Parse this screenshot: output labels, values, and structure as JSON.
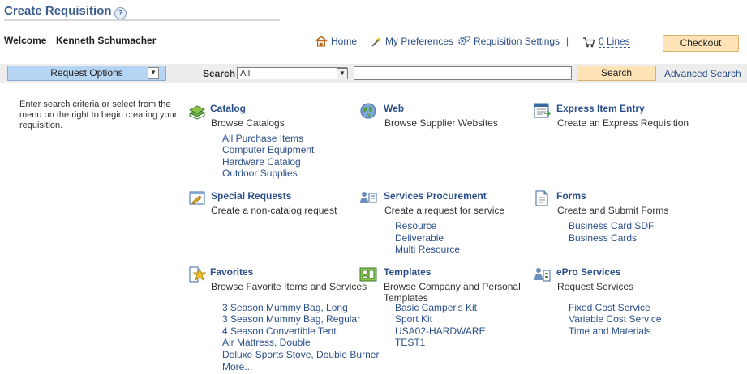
{
  "page": {
    "title": "Create Requisition",
    "help": "?"
  },
  "welcome": {
    "label": "Welcome",
    "name": "Kenneth Schumacher"
  },
  "nav": {
    "home": "Home",
    "preferences": "My Preferences",
    "settings": "Requisition Settings",
    "separator": "|",
    "lines": "0 Lines",
    "checkout": "Checkout"
  },
  "search": {
    "request_options": "Request Options",
    "label": "Search",
    "category_value": "All",
    "query_value": "",
    "button": "Search",
    "advanced": "Advanced Search"
  },
  "instructions": "Enter search criteria or select from the menu on the right to begin creating your requisition.",
  "categories": [
    {
      "title": "Catalog",
      "desc": "Browse Catalogs",
      "icon": "books-icon",
      "items": [
        "All Purchase Items",
        "Computer Equipment",
        "Hardware Catalog",
        "Outdoor Supplies"
      ]
    },
    {
      "title": "Web",
      "desc": "Browse Supplier Websites",
      "icon": "globe-icon",
      "items": []
    },
    {
      "title": "Express Item Entry",
      "desc": "Create an Express Requisition",
      "icon": "express-entry-icon",
      "items": []
    },
    {
      "title": "Special Requests",
      "desc": "Create a non-catalog request",
      "icon": "special-request-icon",
      "items": []
    },
    {
      "title": "Services Procurement",
      "desc": "Create a request for service",
      "icon": "services-icon",
      "items": [
        "Resource",
        "Deliverable",
        "Multi Resource"
      ]
    },
    {
      "title": "Forms",
      "desc": "Create and Submit Forms",
      "icon": "forms-icon",
      "items": [
        "Business Card SDF",
        "Business Cards"
      ]
    },
    {
      "title": "Favorites",
      "desc": "Browse Favorite Items and Services",
      "icon": "favorites-star-icon",
      "items": [
        "3 Season Mummy Bag, Long",
        "3 Season Mummy Bag, Regular",
        "4 Season Convertible Tent",
        "Air Mattress, Double",
        "Deluxe Sports Stove, Double Burner",
        "More..."
      ]
    },
    {
      "title": "Templates",
      "desc": "Browse Company and Personal Templates",
      "icon": "templates-icon",
      "items": [
        "Basic Camper's Kit",
        "Sport Kit",
        "USA02-HARDWARE",
        "TEST1"
      ]
    },
    {
      "title": "ePro Services",
      "desc": "Request Services",
      "icon": "epro-services-icon",
      "items": [
        "Fixed Cost Service",
        "Variable Cost Service",
        "Time and Materials"
      ]
    }
  ]
}
